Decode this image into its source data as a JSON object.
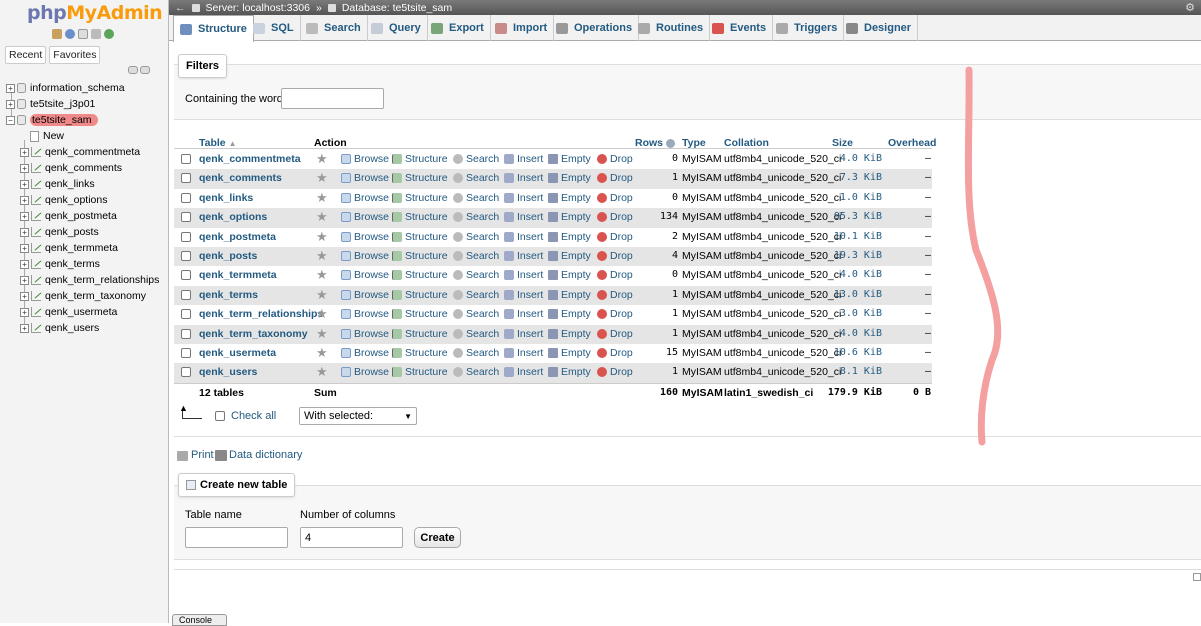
{
  "logo": {
    "part1": "php",
    "part2": "MyAdmin"
  },
  "sidebar": {
    "tabs": [
      "Recent",
      "Favorites"
    ],
    "databases": [
      {
        "name": "information_schema"
      },
      {
        "name": "te5tsite_j3p01"
      },
      {
        "name": "te5tsite_sam"
      }
    ],
    "new_label": "New",
    "tables": [
      "qenk_commentmeta",
      "qenk_comments",
      "qenk_links",
      "qenk_options",
      "qenk_postmeta",
      "qenk_posts",
      "qenk_termmeta",
      "qenk_terms",
      "qenk_term_relationships",
      "qenk_term_taxonomy",
      "qenk_usermeta",
      "qenk_users"
    ]
  },
  "breadcrumb": {
    "server": "Server: localhost:3306",
    "sep": "»",
    "database": "Database: te5tsite_sam"
  },
  "menu": [
    "Structure",
    "SQL",
    "Search",
    "Query",
    "Export",
    "Import",
    "Operations",
    "Routines",
    "Events",
    "Triggers",
    "Designer"
  ],
  "filters": {
    "legend": "Filters",
    "label": "Containing the word:",
    "value": ""
  },
  "table": {
    "headers": {
      "table": "Table",
      "action": "Action",
      "rows": "Rows",
      "type": "Type",
      "collation": "Collation",
      "size": "Size",
      "overhead": "Overhead"
    },
    "sort_arrow": "▲",
    "actions": [
      "Browse",
      "Structure",
      "Search",
      "Insert",
      "Empty",
      "Drop"
    ],
    "rows": [
      {
        "name": "qenk_commentmeta",
        "rows": "0",
        "type": "MyISAM",
        "collation": "utf8mb4_unicode_520_ci",
        "size": "4.0 KiB",
        "overhead": "–"
      },
      {
        "name": "qenk_comments",
        "rows": "1",
        "type": "MyISAM",
        "collation": "utf8mb4_unicode_520_ci",
        "size": "7.3 KiB",
        "overhead": "–"
      },
      {
        "name": "qenk_links",
        "rows": "0",
        "type": "MyISAM",
        "collation": "utf8mb4_unicode_520_ci",
        "size": "1.0 KiB",
        "overhead": "–"
      },
      {
        "name": "qenk_options",
        "rows": "134",
        "type": "MyISAM",
        "collation": "utf8mb4_unicode_520_ci",
        "size": "95.3 KiB",
        "overhead": "–"
      },
      {
        "name": "qenk_postmeta",
        "rows": "2",
        "type": "MyISAM",
        "collation": "utf8mb4_unicode_520_ci",
        "size": "10.1 KiB",
        "overhead": "–"
      },
      {
        "name": "qenk_posts",
        "rows": "4",
        "type": "MyISAM",
        "collation": "utf8mb4_unicode_520_ci",
        "size": "19.3 KiB",
        "overhead": "–"
      },
      {
        "name": "qenk_termmeta",
        "rows": "0",
        "type": "MyISAM",
        "collation": "utf8mb4_unicode_520_ci",
        "size": "4.0 KiB",
        "overhead": "–"
      },
      {
        "name": "qenk_terms",
        "rows": "1",
        "type": "MyISAM",
        "collation": "utf8mb4_unicode_520_ci",
        "size": "13.0 KiB",
        "overhead": "–"
      },
      {
        "name": "qenk_term_relationships",
        "rows": "1",
        "type": "MyISAM",
        "collation": "utf8mb4_unicode_520_ci",
        "size": "3.0 KiB",
        "overhead": "–"
      },
      {
        "name": "qenk_term_taxonomy",
        "rows": "1",
        "type": "MyISAM",
        "collation": "utf8mb4_unicode_520_ci",
        "size": "4.0 KiB",
        "overhead": "–"
      },
      {
        "name": "qenk_usermeta",
        "rows": "15",
        "type": "MyISAM",
        "collation": "utf8mb4_unicode_520_ci",
        "size": "10.6 KiB",
        "overhead": "–"
      },
      {
        "name": "qenk_users",
        "rows": "1",
        "type": "MyISAM",
        "collation": "utf8mb4_unicode_520_ci",
        "size": "8.1 KiB",
        "overhead": "–"
      }
    ],
    "sum": {
      "count": "12 tables",
      "label": "Sum",
      "rows": "160",
      "type": "MyISAM",
      "collation": "latin1_swedish_ci",
      "size": "179.9 KiB",
      "overhead": "0 B"
    }
  },
  "bulk": {
    "check_all": "Check all",
    "with_selected": "With selected:"
  },
  "links": {
    "print": "Print",
    "data_dictionary": "Data dictionary"
  },
  "create": {
    "legend": "Create new table",
    "name_label": "Table name",
    "columns_label": "Number of columns",
    "name_value": "",
    "columns_value": "4",
    "button": "Create"
  },
  "console": "Console",
  "colors": {
    "link": "#235a81",
    "highlight": "#f08a8a",
    "annotation": "#f4a0a0"
  }
}
